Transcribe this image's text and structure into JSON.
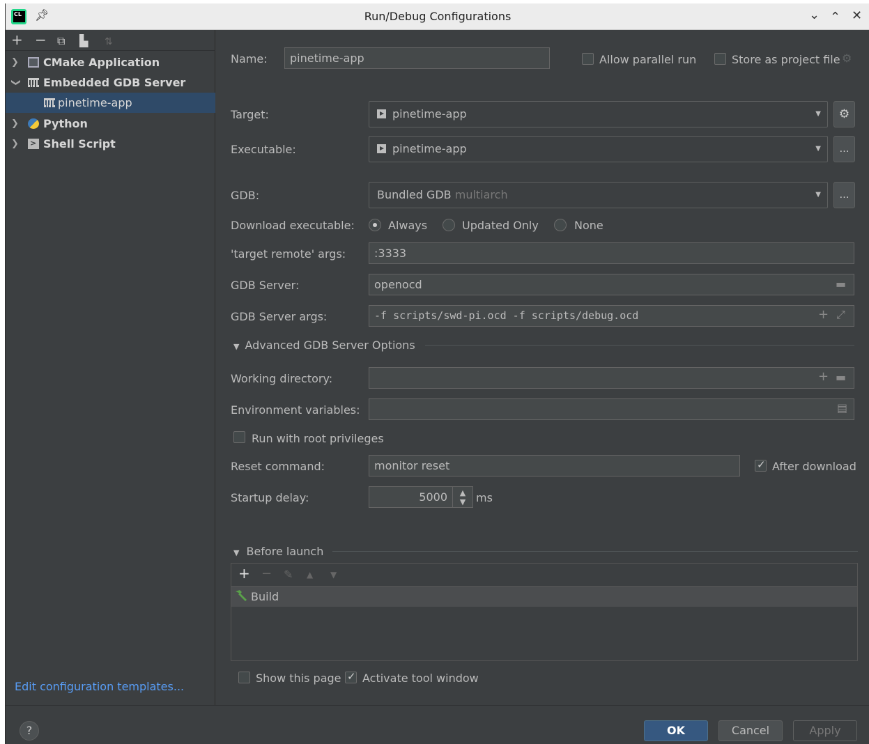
{
  "window": {
    "title": "Run/Debug Configurations",
    "controls": [
      "chevron-down",
      "chevron-up",
      "close"
    ]
  },
  "sidebar": {
    "items": [
      {
        "label": "CMake Application",
        "icon": "cmake-icon",
        "expanded": false
      },
      {
        "label": "Embedded GDB Server",
        "icon": "gdb-server-icon",
        "expanded": true
      },
      {
        "label": "pinetime-app",
        "icon": "gdb-server-icon",
        "selected": true
      },
      {
        "label": "Python",
        "icon": "python-icon",
        "expanded": false
      },
      {
        "label": "Shell Script",
        "icon": "shell-icon",
        "expanded": false
      }
    ],
    "edit_templates": "Edit configuration templates..."
  },
  "form": {
    "name_label": "Name:",
    "name_value": "pinetime-app",
    "allow_parallel": "Allow parallel run",
    "store_project": "Store as project file",
    "target_label": "Target:",
    "target_value": "pinetime-app",
    "executable_label": "Executable:",
    "executable_value": "pinetime-app",
    "gdb_label": "GDB:",
    "gdb_value": "Bundled GDB",
    "gdb_value_hint": "multiarch",
    "download_label": "Download executable:",
    "download_options": [
      "Always",
      "Updated Only",
      "None"
    ],
    "download_selected": "Always",
    "target_remote_label": "'target remote' args:",
    "target_remote_value": ":3333",
    "gdb_server_label": "GDB Server:",
    "gdb_server_value": "openocd",
    "gdb_server_args_label": "GDB Server args:",
    "gdb_server_args_value": "-f scripts/swd-pi.ocd -f scripts/debug.ocd",
    "advanced_title": "Advanced GDB Server Options",
    "working_dir_label": "Working directory:",
    "working_dir_value": "",
    "env_vars_label": "Environment variables:",
    "env_vars_value": "",
    "root_priv": "Run with root privileges",
    "reset_cmd_label": "Reset command:",
    "reset_cmd_value": "monitor reset",
    "after_download": "After download",
    "startup_delay_label": "Startup delay:",
    "startup_delay_value": "5000",
    "startup_delay_unit": "ms",
    "before_launch_title": "Before launch",
    "before_launch_items": [
      "Build"
    ],
    "show_page": "Show this page",
    "activate_tool": "Activate tool window"
  },
  "buttons": {
    "help": "?",
    "ok": "OK",
    "cancel": "Cancel",
    "apply": "Apply"
  },
  "colors": {
    "background": "#3c3f41",
    "selection": "#2f4a68",
    "link": "#589df6",
    "ok_button": "#365880"
  }
}
